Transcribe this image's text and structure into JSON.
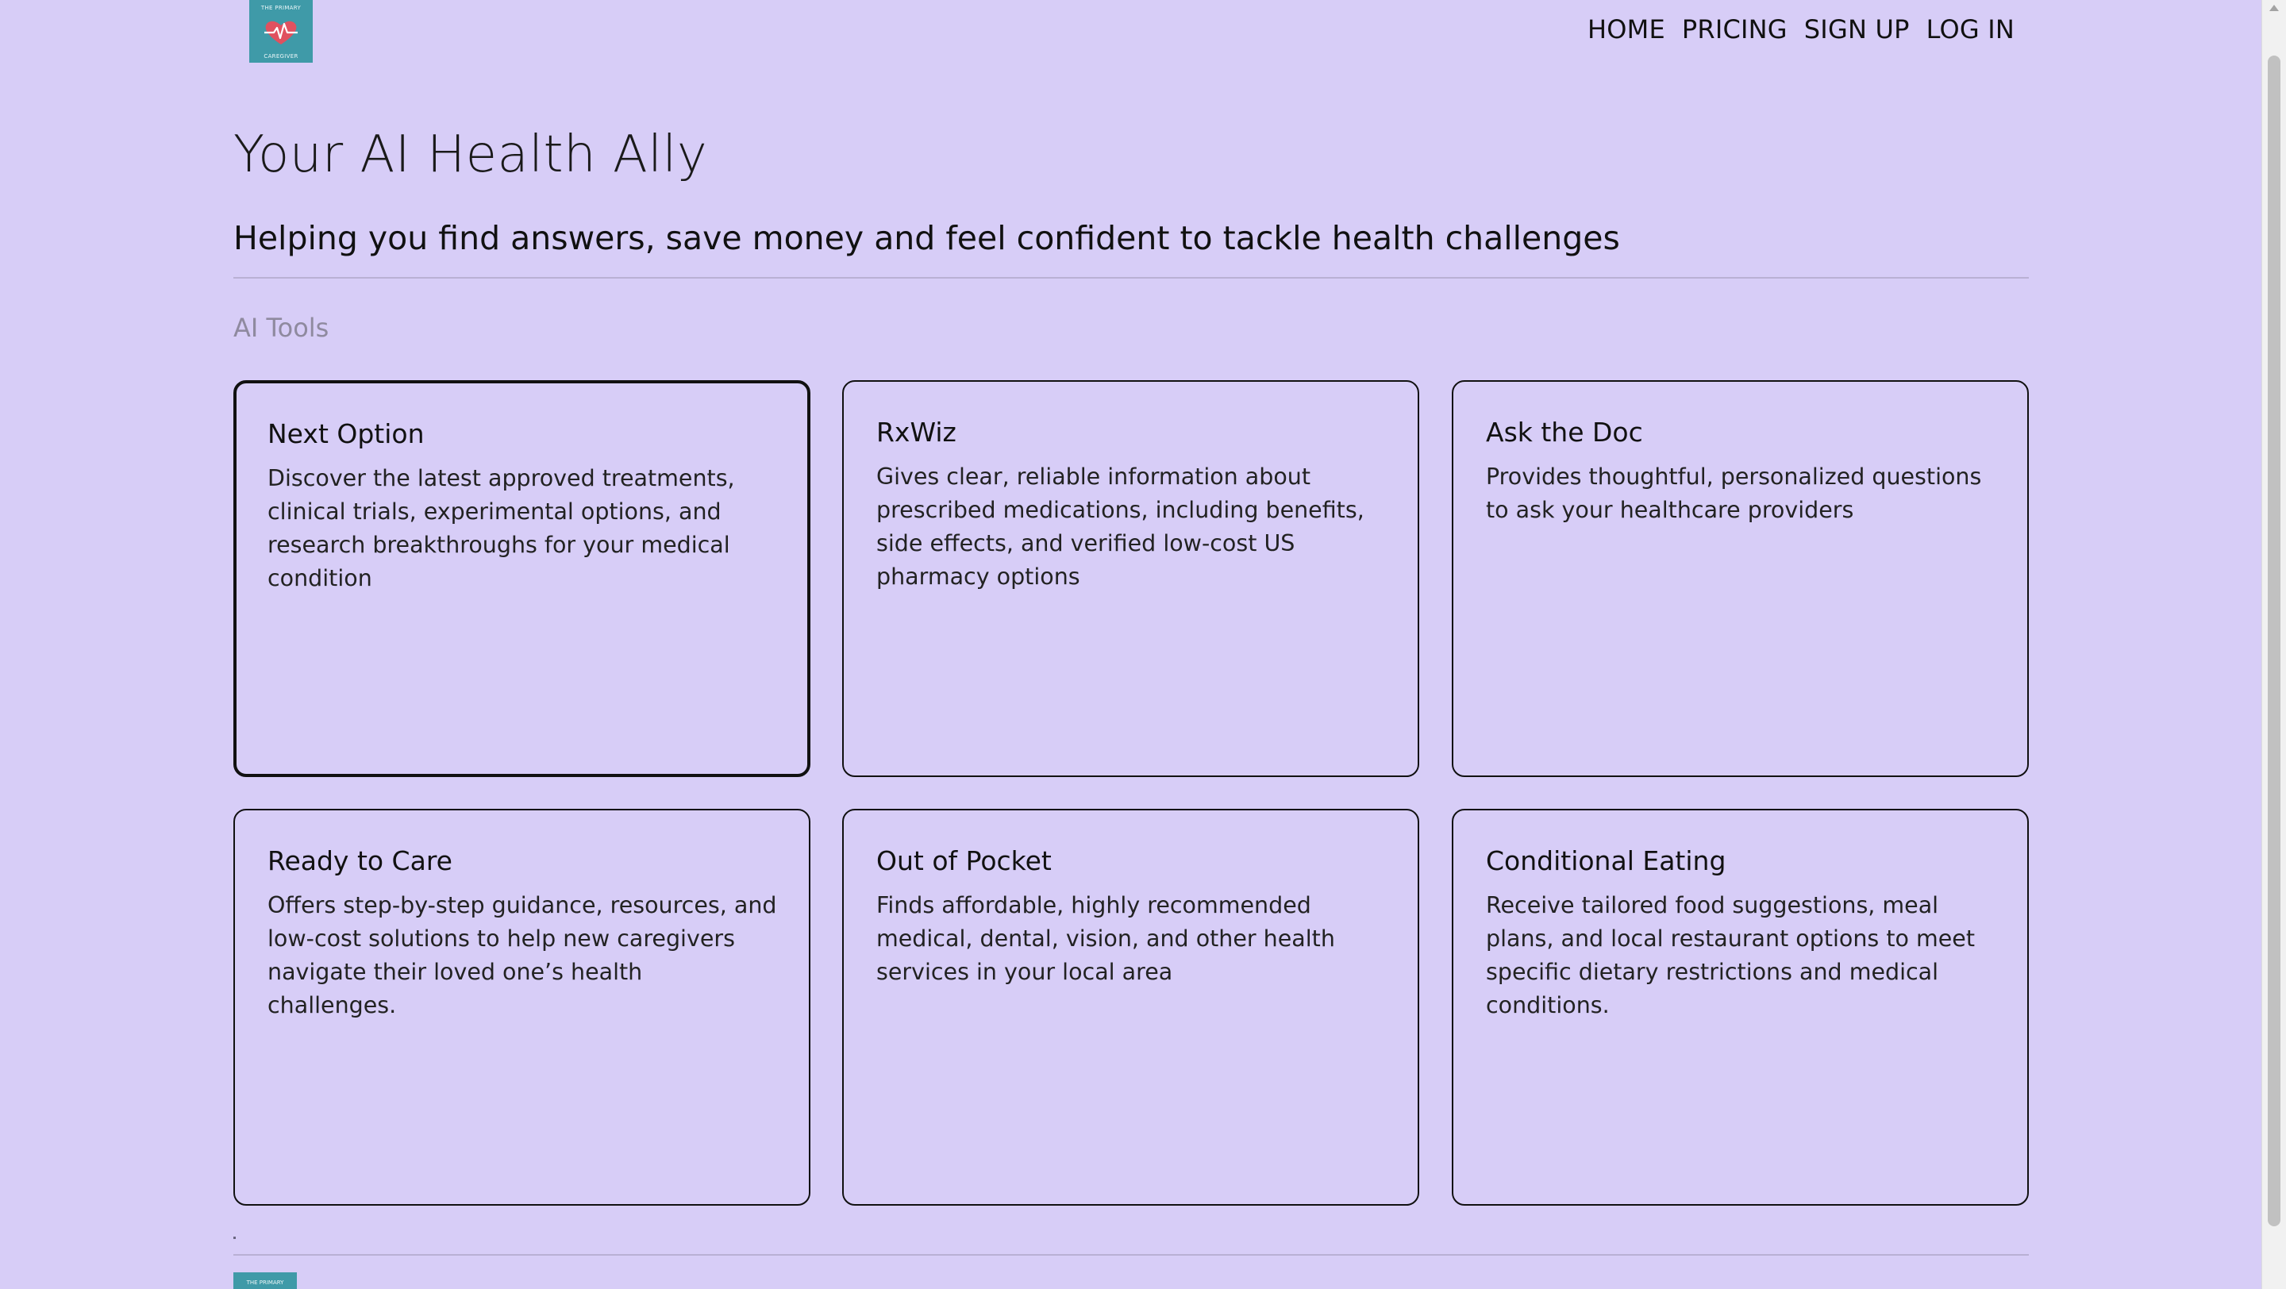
{
  "header": {
    "logo": {
      "top_text": "THE PRIMARY",
      "bottom_text": "CAREGIVER",
      "icon": "heart-pulse-icon",
      "bg_color": "#3f9aa8",
      "heart_color": "#e0515f"
    },
    "nav": [
      {
        "label": "HOME"
      },
      {
        "label": "PRICING"
      },
      {
        "label": "SIGN UP"
      },
      {
        "label": "LOG IN"
      }
    ]
  },
  "hero": {
    "title": "Your AI Health Ally",
    "subtitle": "Helping you find answers, save money and feel confident to tackle health challenges"
  },
  "section": {
    "label": "AI Tools"
  },
  "cards": [
    {
      "title": "Next Option",
      "description": "Discover the latest approved treatments, clinical trials, experimental options, and research breakthroughs for your medical condition"
    },
    {
      "title": "RxWiz",
      "description": "Gives clear, reliable information about prescribed medications, including benefits, side effects, and verified low-cost US pharmacy options"
    },
    {
      "title": "Ask the Doc",
      "description": "Provides thoughtful, personalized questions to ask your healthcare providers"
    },
    {
      "title": "Ready to Care",
      "description": "Offers step-by-step guidance, resources, and low-cost solutions to help new caregivers navigate their loved one’s health challenges."
    },
    {
      "title": "Out of Pocket",
      "description": "Finds affordable, highly recommended medical, dental, vision, and other health services in your local area"
    },
    {
      "title": "Conditional Eating",
      "description": "Receive tailored food suggestions, meal plans, and local restaurant options to meet specific dietary restrictions and medical conditions."
    }
  ],
  "footer": {
    "logo_text": "THE PRIMARY"
  },
  "theme": {
    "background": "#d7cdf7",
    "text": "#111111",
    "muted": "#8f8a9f"
  }
}
